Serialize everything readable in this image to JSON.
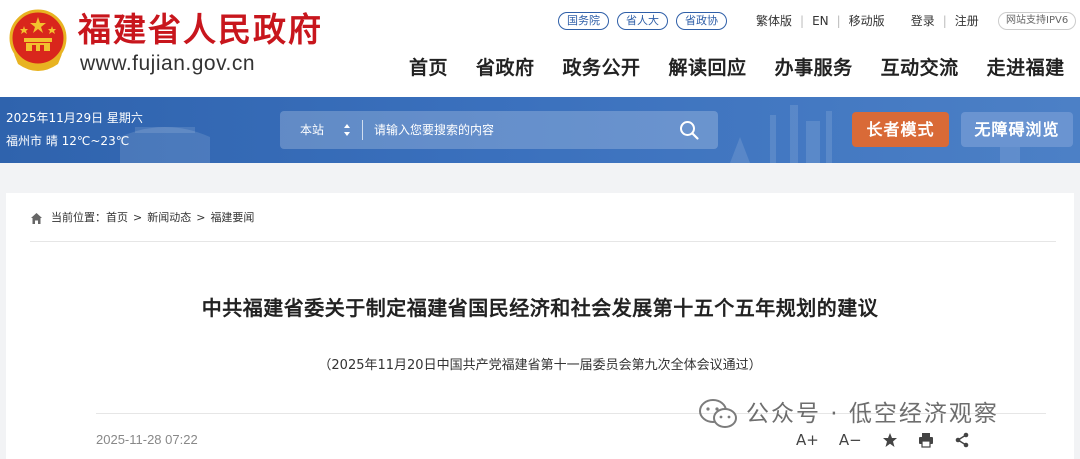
{
  "site": {
    "name": "福建省人民政府",
    "url": "www.fujian.gov.cn"
  },
  "header": {
    "tags": [
      "国务院",
      "省人大",
      "省政协"
    ],
    "links": [
      "繁体版",
      "EN",
      "移动版"
    ],
    "account": [
      "登录",
      "注册"
    ],
    "ipv6": "网站支持IPV6"
  },
  "nav": [
    "首页",
    "省政府",
    "政务公开",
    "解读回应",
    "办事服务",
    "互动交流",
    "走进福建"
  ],
  "banner": {
    "date": "2025年11月29日 星期六",
    "weather": "福州市 晴 12℃~23℃",
    "search_scope": "本站",
    "search_placeholder": "请输入您要搜索的内容",
    "elder_mode": "长者模式",
    "accessibility": "无障碍浏览"
  },
  "breadcrumb": {
    "prefix": "当前位置：",
    "items": [
      "首页",
      "新闻动态",
      "福建要闻"
    ]
  },
  "article": {
    "title": "中共福建省委关于制定福建省国民经济和社会发展第十五个五年规划的建议",
    "subtitle": "（2025年11月20日中国共产党福建省第十一届委员会第九次全体会议通过）",
    "date": "2025-11-28 07:22"
  },
  "tools": {
    "font_increase": "A+",
    "font_decrease": "A−"
  },
  "watermark": {
    "text": "公众号 · 低空经济观察"
  },
  "colors": {
    "brand_red": "#c8161d",
    "banner_blue": "#3a70bd",
    "elder_orange": "#d96a37",
    "access_blue": "#6a94d1"
  },
  "icons": [
    "national-emblem-icon",
    "scope-arrow-icon",
    "search-icon",
    "home-icon",
    "star-icon",
    "print-icon",
    "share-icon",
    "wechat-icon"
  ]
}
